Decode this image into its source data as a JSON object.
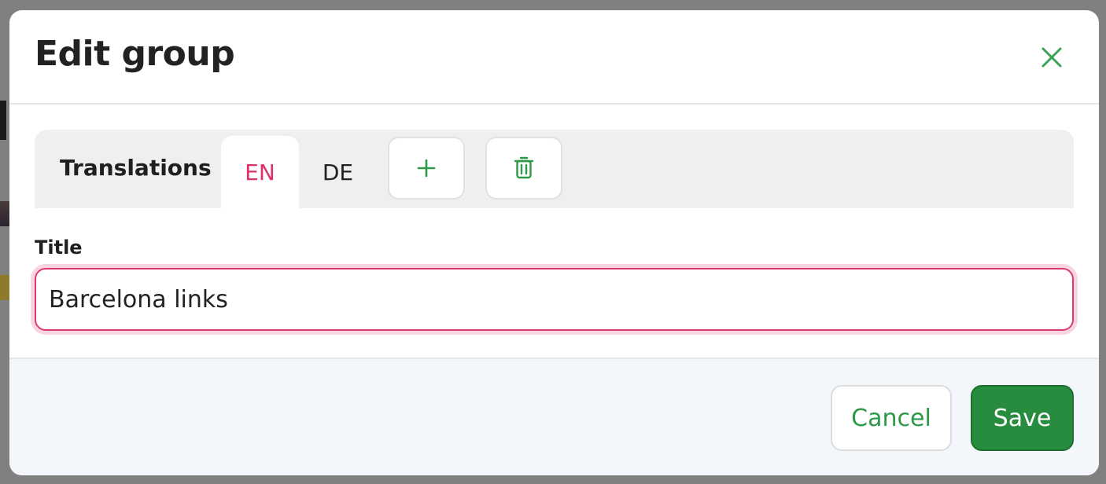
{
  "dialog": {
    "title": "Edit group",
    "close_icon": "close-icon"
  },
  "translations": {
    "label": "Translations",
    "tabs": [
      {
        "label": "EN",
        "active": true
      },
      {
        "label": "DE",
        "active": false
      }
    ],
    "add_icon": "plus-icon",
    "delete_icon": "trash-icon"
  },
  "form": {
    "title_label": "Title",
    "title_value": "Barcelona links"
  },
  "footer": {
    "cancel_label": "Cancel",
    "save_label": "Save"
  },
  "colors": {
    "accent_green": "#2c9a48",
    "save_bg": "#278c3d",
    "active_tab": "#de2f6e",
    "focus_border": "#dc3a74"
  }
}
